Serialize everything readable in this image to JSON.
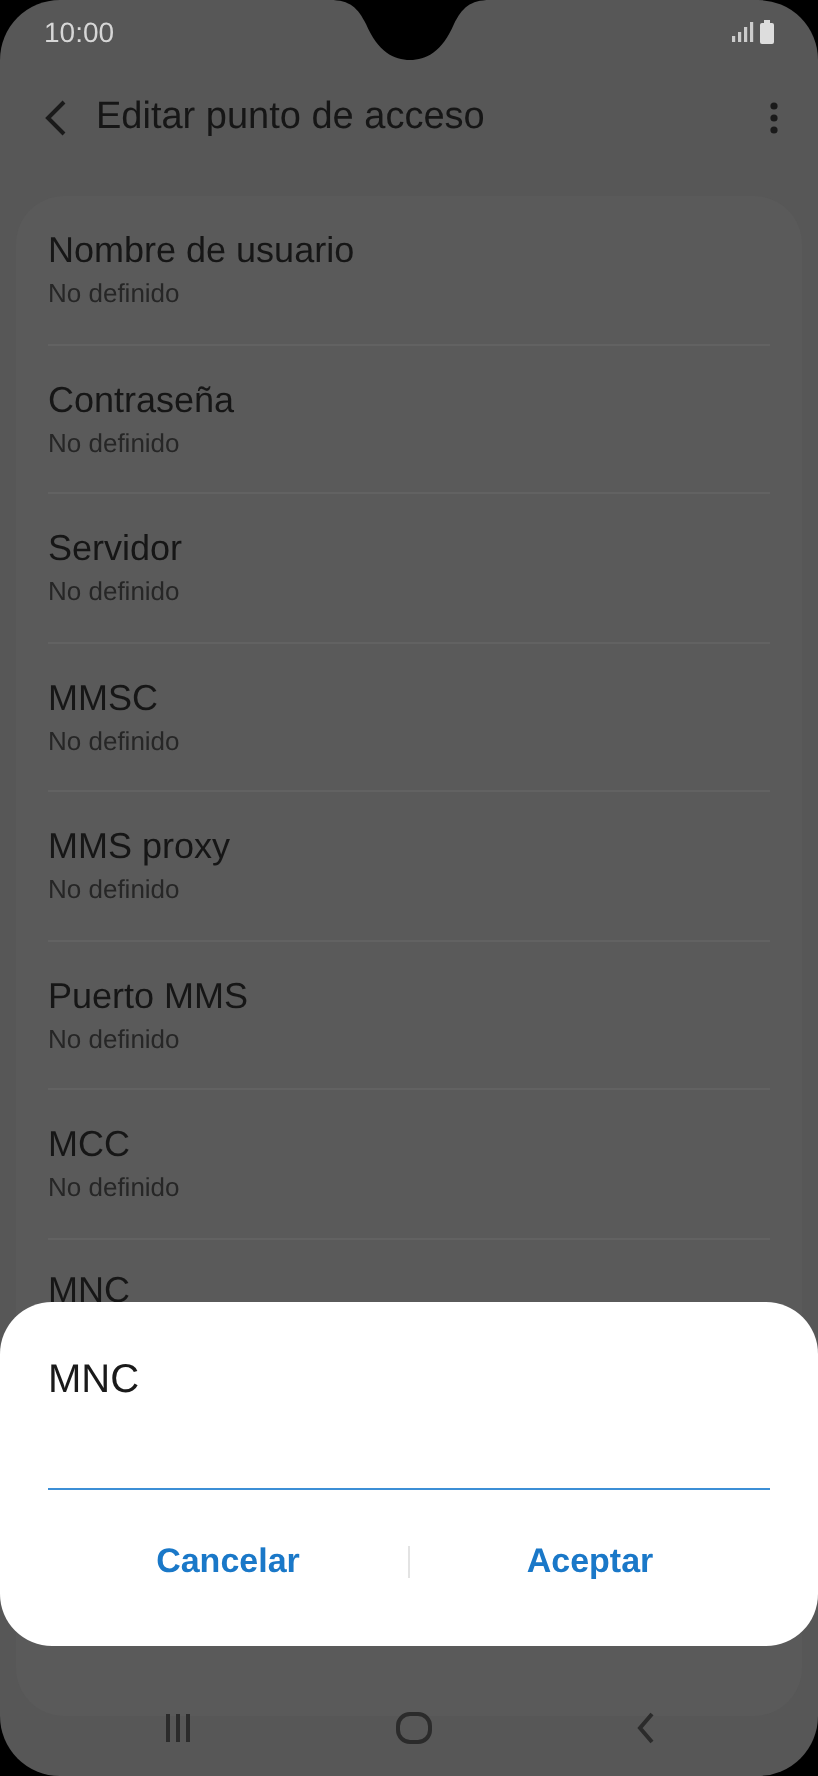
{
  "status_bar": {
    "time": "10:00"
  },
  "header": {
    "title": "Editar punto de acceso"
  },
  "items": [
    {
      "title": "Nombre de usuario",
      "value": "No definido"
    },
    {
      "title": "Contraseña",
      "value": "No definido"
    },
    {
      "title": "Servidor",
      "value": "No definido"
    },
    {
      "title": "MMSC",
      "value": "No definido"
    },
    {
      "title": "MMS proxy",
      "value": "No definido"
    },
    {
      "title": "Puerto MMS",
      "value": "No definido"
    },
    {
      "title": "MCC",
      "value": "No definido"
    },
    {
      "title": "MNC"
    }
  ],
  "dialog": {
    "title": "MNC",
    "buttons": [
      "Cancelar",
      "Aceptar"
    ]
  }
}
